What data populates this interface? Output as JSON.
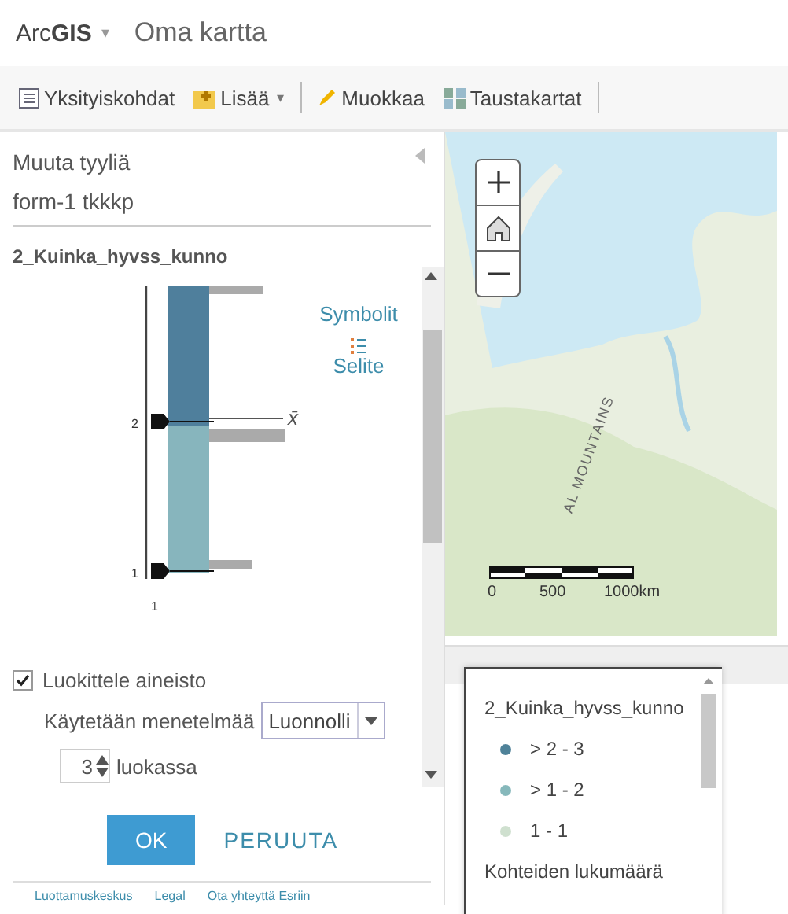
{
  "header": {
    "brand_light": "Arc",
    "brand_bold": "GIS",
    "brand_caret": "▾",
    "title": "Oma kartta"
  },
  "toolbar": {
    "items": [
      {
        "kind": "details",
        "label": "Yksityiskohdat"
      },
      {
        "kind": "add",
        "label": "Lisää",
        "caret": "▾"
      },
      {
        "kind": "edit",
        "label": "Muokkaa"
      },
      {
        "kind": "basemap",
        "label": "Taustakartat"
      }
    ]
  },
  "style_panel": {
    "heading": "Muuta tyyliä",
    "layer_name": "form-1 tkkkp",
    "field_name": "2_Kuinka_hyvss_kunno",
    "histogram": {
      "handles": [
        "2",
        "1"
      ],
      "mean_label": "x̄",
      "axis_label": "1"
    },
    "side_tabs": [
      {
        "kind": "symbols",
        "label": "Symbolit"
      },
      {
        "kind": "legend",
        "label": "Selite"
      }
    ],
    "classify": {
      "label": "Luokittele aineisto",
      "checked": true
    },
    "method": {
      "label": "Käytetään menetelmää",
      "value": "Luonnolli"
    },
    "classes": {
      "value": "3",
      "label": "luokassa"
    },
    "buttons": [
      {
        "kind": "primary",
        "label": "OK"
      },
      {
        "kind": "secondary",
        "label": "PERUUTA"
      }
    ]
  },
  "footer": {
    "links": [
      "Luottamuskeskus",
      "Legal",
      "Ota yhteyttä Esriin"
    ]
  },
  "map": {
    "label": "AL MOUNTAINS",
    "scale": [
      "0",
      "500",
      "1000km"
    ]
  },
  "legend": {
    "field": "2_Kuinka_hyvss_kunno",
    "items": [
      {
        "label": "> 2 - 3",
        "color": "#4f8299"
      },
      {
        "label": "> 1 - 2",
        "color": "#86b8bb"
      },
      {
        "label": "1 - 1",
        "color": "#cfe0cf"
      }
    ],
    "count_title": "Kohteiden lukumäärä"
  }
}
